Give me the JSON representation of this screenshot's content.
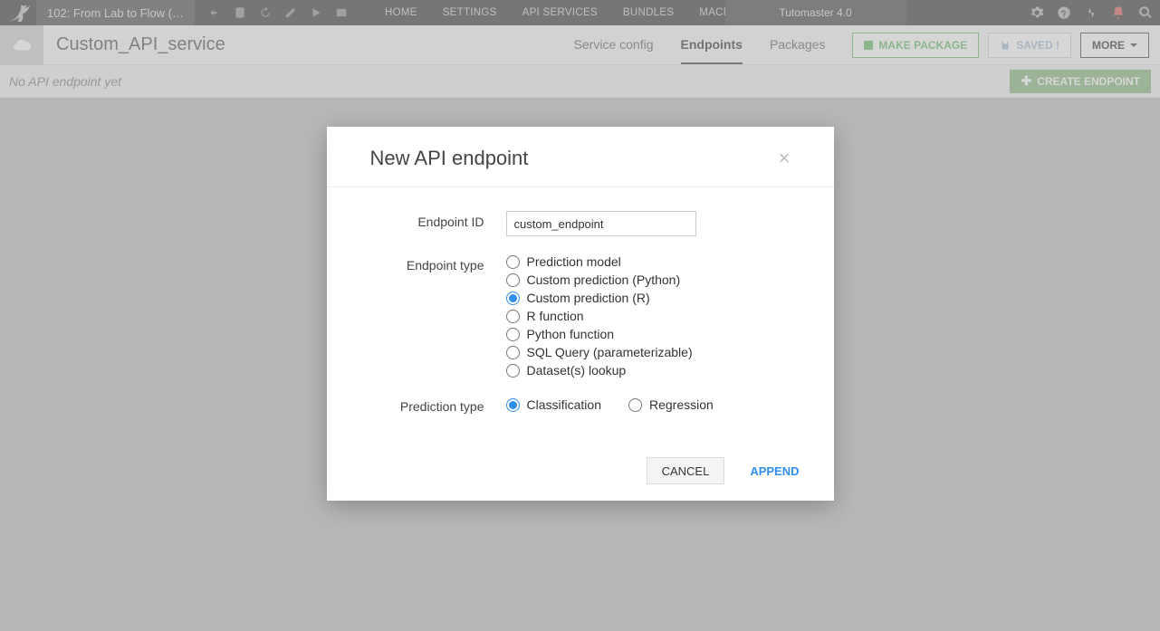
{
  "topbar": {
    "project": "102: From Lab to Flow (…",
    "nav": [
      "HOME",
      "SETTINGS",
      "API SERVICES",
      "BUNDLES",
      "MACROS"
    ],
    "active_nav": 2,
    "tutomaster": "Tutomaster 4.0"
  },
  "subheader": {
    "service_name": "Custom_API_service",
    "tabs": [
      "Service config",
      "Endpoints",
      "Packages"
    ],
    "active_tab": 1,
    "make_package": "MAKE PACKAGE",
    "saved": "SAVED !",
    "more": "MORE"
  },
  "toolbar": {
    "empty": "No API endpoint yet",
    "create": "CREATE ENDPOINT"
  },
  "modal": {
    "title": "New API endpoint",
    "labels": {
      "id": "Endpoint ID",
      "type": "Endpoint type",
      "pred": "Prediction type"
    },
    "endpoint_id": "custom_endpoint",
    "types": [
      "Prediction model",
      "Custom prediction (Python)",
      "Custom prediction (R)",
      "R function",
      "Python function",
      "SQL Query (parameterizable)",
      "Dataset(s) lookup"
    ],
    "type_selected": 2,
    "preds": [
      "Classification",
      "Regression"
    ],
    "pred_selected": 0,
    "cancel": "CANCEL",
    "append": "APPEND"
  }
}
